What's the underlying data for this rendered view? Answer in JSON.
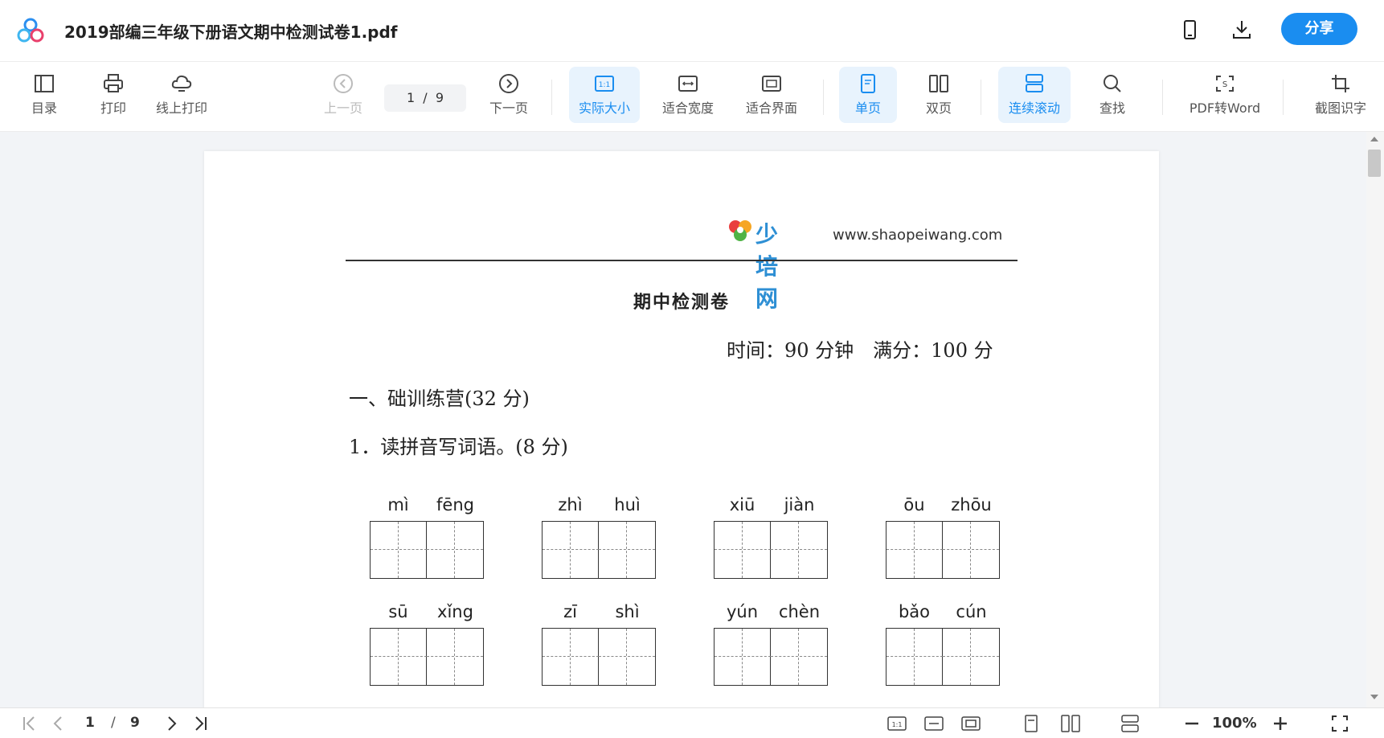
{
  "titlebar": {
    "file_name": "2019部编三年级下册语文期中检测试卷1.pdf",
    "share_label": "分享",
    "icons": [
      "app-logo",
      "phone-icon",
      "download-icon"
    ]
  },
  "toolbar": {
    "toc": "目录",
    "print": "打印",
    "online_print": "线上打印",
    "prev_page": "上一页",
    "page_current": "1",
    "page_sep": "/",
    "page_total": "9",
    "next_page": "下一页",
    "actual_size": "实际大小",
    "fit_width": "适合宽度",
    "fit_screen": "适合界面",
    "single_page": "单页",
    "double_page": "双页",
    "continuous_scroll": "连续滚动",
    "find": "查找",
    "pdf_to_word": "PDF转Word",
    "screenshot_ocr": "截图识字",
    "active_color": "#1a8df0"
  },
  "document": {
    "brand_name": "少培网",
    "brand_url": "www.shaopeiwang.com",
    "title": "期中检测卷",
    "meta": "时间：90 分钟　满分：100 分",
    "section": "一、础训练营(32 分)",
    "question": "1．读拼音写词语。(8 分)",
    "pinyin_rows": [
      [
        [
          "mì",
          "fēng"
        ],
        [
          "zhì",
          "huì"
        ],
        [
          "xiū",
          "jiàn"
        ],
        [
          "ōu",
          "zhōu"
        ]
      ],
      [
        [
          "sū",
          "xǐng"
        ],
        [
          "zī",
          "shì"
        ],
        [
          "yún",
          "chèn"
        ],
        [
          "bǎo",
          "cún"
        ]
      ]
    ]
  },
  "statusbar": {
    "page_current": "1",
    "page_sep": "/",
    "page_total": "9",
    "zoom": "100%"
  }
}
